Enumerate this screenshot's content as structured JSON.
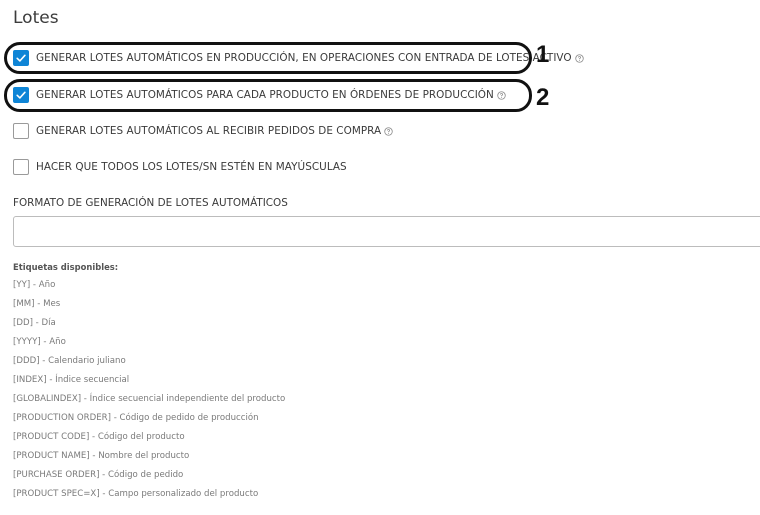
{
  "section": {
    "title": "Lotes"
  },
  "options": [
    {
      "label": "GENERAR LOTES AUTOMÁTICOS EN PRODUCCIÓN, EN OPERACIONES CON ENTRADA DE LOTES ACTIVO",
      "checked": true,
      "help": true
    },
    {
      "label": "GENERAR LOTES AUTOMÁTICOS PARA CADA PRODUCTO EN ÓRDENES DE PRODUCCIÓN",
      "checked": true,
      "help": true
    },
    {
      "label": "GENERAR LOTES AUTOMÁTICOS AL RECIBIR PEDIDOS DE COMPRA",
      "checked": false,
      "help": true
    },
    {
      "label": "HACER QUE TODOS LOS LOTES/SN ESTÉN EN MAYÚSCULAS",
      "checked": false,
      "help": false
    }
  ],
  "callouts": [
    "1",
    "2"
  ],
  "format_field": {
    "label": "FORMATO DE GENERACIÓN DE LOTES AUTOMÁTICOS",
    "value": "",
    "placeholder": ""
  },
  "tags": {
    "title": "Etiquetas disponibles:",
    "items": [
      "[YY] - Año",
      "[MM] - Mes",
      "[DD] - Día",
      "[YYYY] - Año",
      "[DDD] - Calendario juliano",
      "[INDEX] - Índice secuencial",
      "[GLOBALINDEX] - Índice secuencial independiente del producto",
      "[PRODUCTION ORDER] - Código de pedido de producción",
      "[PRODUCT CODE] - Código del producto",
      "[PRODUCT NAME] - Nombre del producto",
      "[PURCHASE ORDER] - Código de pedido",
      "[PRODUCT SPEC=X] - Campo personalizado del producto"
    ]
  },
  "colors": {
    "accent": "#0f85d6",
    "callout": "#111111"
  },
  "icons": {
    "checkbox_checked": "checkmark-icon",
    "help": "help-circle-icon"
  }
}
